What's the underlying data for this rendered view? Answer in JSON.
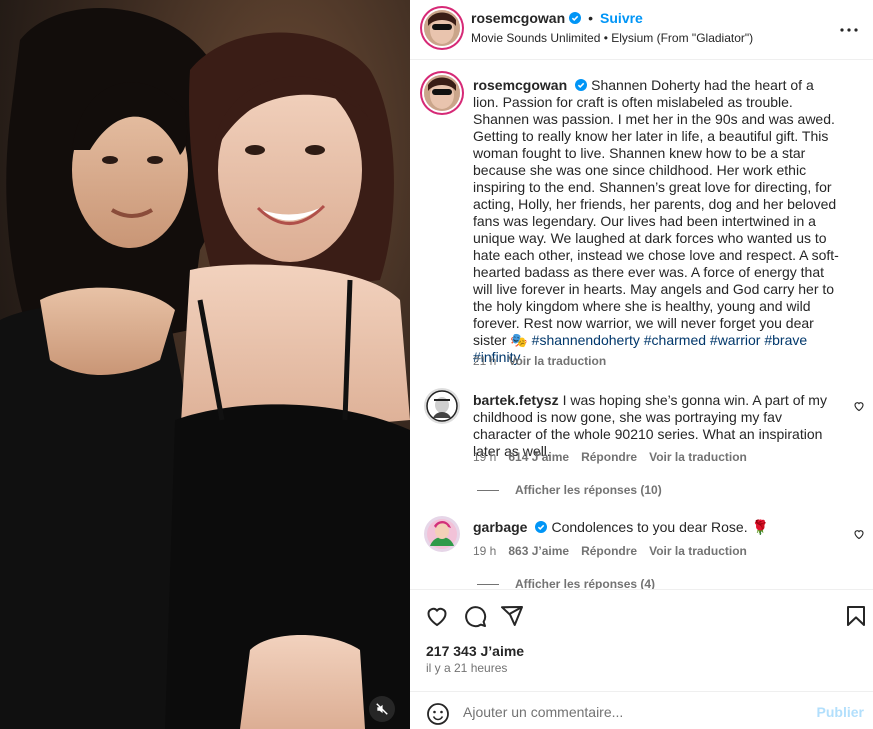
{
  "post": {
    "username": "rosemcgowan",
    "follow_label": "Suivre",
    "dot": "•",
    "audio": "Movie Sounds Unlimited • Elysium (From \"Gladiator\")",
    "more_icon": "more-horizontal-icon"
  },
  "caption": {
    "username": "rosemcgowan",
    "text": "Shannen Doherty had the heart of a lion. Passion for craft is often mislabeled as trouble. Shannen was passion. I met her in the 90s and was awed. Getting to really know her later in life, a beautiful gift. This woman fought to live. Shannen knew how to be a star because she was one since childhood. Her work ethic inspiring to the end. Shannen’s great love for directing, for acting, Holly, her friends, her parents, dog and her beloved fans was legendary. Our lives had been intertwined in a unique way. We laughed at dark forces who wanted us to hate each other, instead we chose love and respect. A soft-hearted badass as there ever was. A force of energy that will live forever in hearts. May angels and God carry her to the holy kingdom where she is healthy, young and wild forever. Rest now warrior, we will never forget you dear sister 🎭 ",
    "hashtags": "#shannendoherty #charmed #warrior #brave #infinity",
    "time": "21 h",
    "translate": "Voir la traduction"
  },
  "comments": [
    {
      "username": "bartek.fetysz",
      "text": "I was hoping she’s gonna win. A part of my childhood is now gone, she was portraying my fav character of the whole 90210 series. What an inspiration later as well.",
      "time": "19 h",
      "likes": "614 J’aime",
      "reply": "Répondre",
      "translate": "Voir la traduction",
      "view_replies": "Afficher les réponses (10)"
    },
    {
      "username": "garbage",
      "text": "Condolences to you dear Rose. 🌹",
      "time": "19 h",
      "likes": "863 J’aime",
      "reply": "Répondre",
      "translate": "Voir la traduction",
      "view_replies": "Afficher les réponses (4)"
    }
  ],
  "stats": {
    "likes": "217 343 J’aime",
    "ago": "il y a 21 heures"
  },
  "composer": {
    "placeholder": "Ajouter un commentaire...",
    "publish": "Publier"
  },
  "icons": {
    "like": "heart-icon",
    "comment": "comment-icon",
    "share": "share-icon",
    "save": "bookmark-icon",
    "emoji": "emoji-icon",
    "mute": "muted-speaker-icon"
  },
  "colors": {
    "link": "#0095f6",
    "hashtag": "#00376b",
    "muted": "#737373",
    "publish_disabled": "#b2dffc"
  }
}
